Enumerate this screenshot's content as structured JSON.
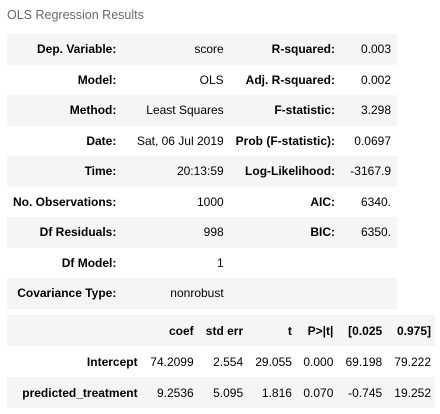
{
  "caption": "OLS Regression Results",
  "summary": {
    "rows": [
      {
        "l1": "Dep. Variable:",
        "v1": "score",
        "l2": "R-squared:",
        "v2": "0.003"
      },
      {
        "l1": "Model:",
        "v1": "OLS",
        "l2": "Adj. R-squared:",
        "v2": "0.002"
      },
      {
        "l1": "Method:",
        "v1": "Least Squares",
        "l2": "F-statistic:",
        "v2": "3.298"
      },
      {
        "l1": "Date:",
        "v1": "Sat, 06 Jul 2019",
        "l2": "Prob (F-statistic):",
        "v2": "0.0697"
      },
      {
        "l1": "Time:",
        "v1": "20:13:59",
        "l2": "Log-Likelihood:",
        "v2": "-3167.9"
      },
      {
        "l1": "No. Observations:",
        "v1": "1000",
        "l2": "AIC:",
        "v2": "6340."
      },
      {
        "l1": "Df Residuals:",
        "v1": "998",
        "l2": "BIC:",
        "v2": "6350."
      },
      {
        "l1": "Df Model:",
        "v1": "1",
        "l2": "",
        "v2": ""
      },
      {
        "l1": "Covariance Type:",
        "v1": "nonrobust",
        "l2": "",
        "v2": ""
      }
    ]
  },
  "coefficients": {
    "headers": [
      "",
      "coef",
      "std err",
      "t",
      "P>|t|",
      "[0.025",
      "0.975]"
    ],
    "rows": [
      {
        "name": "Intercept",
        "coef": "74.2099",
        "std_err": "2.554",
        "t": "29.055",
        "p": "0.000",
        "lo": "69.198",
        "hi": "79.222"
      },
      {
        "name": "predicted_treatment",
        "coef": "9.2536",
        "std_err": "5.095",
        "t": "1.816",
        "p": "0.070",
        "lo": "-0.745",
        "hi": "19.252"
      }
    ]
  }
}
